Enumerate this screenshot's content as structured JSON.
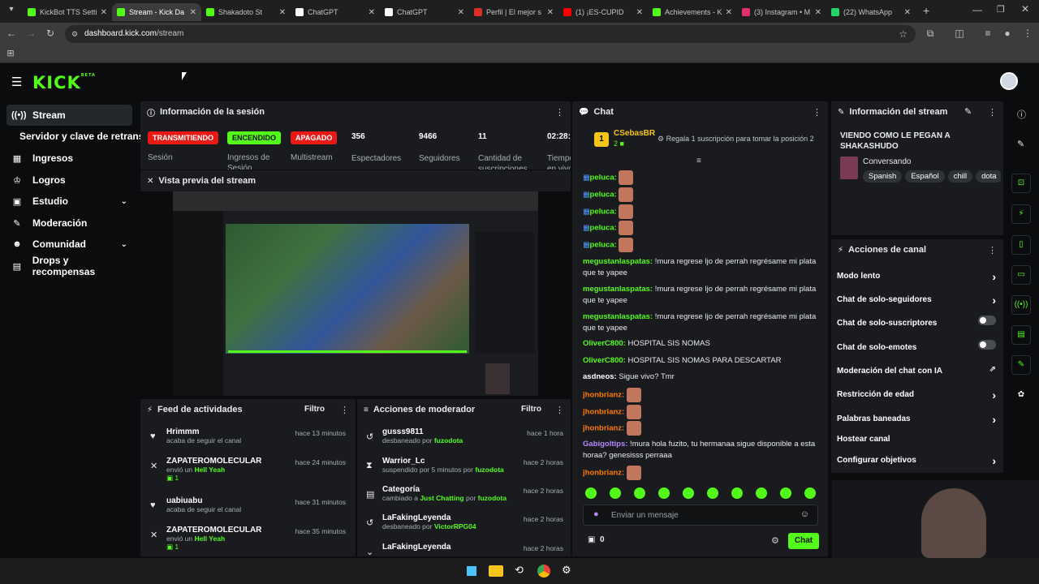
{
  "browser": {
    "tabs": [
      {
        "title": "KickBot TTS Setti",
        "color": "#53fc18"
      },
      {
        "title": "Stream - Kick Da",
        "color": "#53fc18",
        "active": true
      },
      {
        "title": "Shakadoto St",
        "color": "#53fc18"
      },
      {
        "title": "ChatGPT",
        "color": "#ffffff"
      },
      {
        "title": "ChatGPT",
        "color": "#ffffff"
      },
      {
        "title": "Perfil | El mejor s",
        "color": "#d93025"
      },
      {
        "title": "(1) ¡ES-CUPID",
        "color": "#ff0000"
      },
      {
        "title": "Achievements - K",
        "color": "#53fc18"
      },
      {
        "title": "(3) Instagram • M",
        "color": "#e1306c"
      },
      {
        "title": "(22) WhatsApp",
        "color": "#25d366"
      }
    ],
    "url_host": "dashboard.kick.com",
    "url_path": "/stream"
  },
  "header": {
    "logo": "KICK",
    "logo_sup": "BETA"
  },
  "sidebar": {
    "items": [
      {
        "label": "Stream",
        "icon": "broadcast-icon"
      },
      {
        "label": "Servidor y clave de retransmisión",
        "icon": ""
      },
      {
        "label": "Ingresos",
        "icon": "chart-icon"
      },
      {
        "label": "Logros",
        "icon": "trophy-icon"
      },
      {
        "label": "Estudio",
        "icon": "studio-icon"
      },
      {
        "label": "Moderación",
        "icon": "wrench-icon"
      },
      {
        "label": "Comunidad",
        "icon": "people-icon"
      },
      {
        "label": "Drops y recompensas",
        "icon": "gift-icon"
      }
    ]
  },
  "session": {
    "title": "Información de la sesión",
    "transmitting": "TRANSMITIENDO",
    "session_label": "Sesión",
    "encendido": "ENCENDIDO",
    "ingresos_label": "Ingresos de Sesión",
    "apagado": "APAGADO",
    "multistream_label": "Multistream",
    "viewers": "356",
    "viewers_label": "Espectadores",
    "followers": "9466",
    "followers_label": "Seguidores",
    "subs": "11",
    "subs_label": "Cantidad de suscripciones",
    "time": "02:28:",
    "time_label": "Tiempo en vivo"
  },
  "preview": {
    "title": "Vista previa del stream"
  },
  "feed": {
    "title": "Feed de actividades",
    "filter": "Filtro",
    "items": [
      {
        "name": "Hrimmm",
        "desc": "acaba de seguir el canal",
        "time": "hace 13 minutos"
      },
      {
        "name": "ZAPATEROMOLECULAR",
        "desc_pre": "envió un ",
        "desc_link": "Hell Yeah",
        "amount": "1",
        "time": "hace 24 minutos"
      },
      {
        "name": "uabiuabu",
        "desc": "acaba de seguir el canal",
        "time": "hace 31 minutos"
      },
      {
        "name": "ZAPATEROMOLECULAR",
        "desc_pre": "envió un ",
        "desc_link": "Hell Yeah",
        "amount": "1",
        "time": "hace 35 minutos"
      }
    ]
  },
  "modactions": {
    "title": "Acciones de moderador",
    "filter": "Filtro",
    "items": [
      {
        "name": "gusss9811",
        "desc_pre": "desbaneado por ",
        "by": "fuzodota",
        "time": "hace 1 hora"
      },
      {
        "name": "Warrior_Lc",
        "desc_pre": "suspendido por 5 minutos por ",
        "by": "fuzodota",
        "time": "hace 2 horas"
      },
      {
        "name": "Categoría",
        "desc_pre": "cambiado a ",
        "cat": "Just Chatting",
        "desc_mid": " por ",
        "by": "fuzodota",
        "time": "hace 2 horas"
      },
      {
        "name": "LaFakingLeyenda",
        "desc_pre": "desbaneado por ",
        "by": "VictorRPG04",
        "time": "hace 2 horas"
      },
      {
        "name": "LaFakingLeyenda",
        "desc_pre": "",
        "by": "",
        "time": "hace 2 horas"
      }
    ]
  },
  "chat": {
    "title": "Chat",
    "top_user": "CSebasBR",
    "top_rank": "1",
    "top_count": "2",
    "gift_text": "Regala 1 suscripción para tomar la posición 2",
    "messages": [
      {
        "user": "peluca:",
        "color": "#53fc18",
        "text": "",
        "emote": true
      },
      {
        "user": "peluca:",
        "color": "#53fc18",
        "text": "",
        "emote": true
      },
      {
        "user": "peluca:",
        "color": "#53fc18",
        "text": "",
        "emote": true
      },
      {
        "user": "peluca:",
        "color": "#53fc18",
        "text": "",
        "emote": true
      },
      {
        "user": "peluca:",
        "color": "#53fc18",
        "text": "",
        "emote": true
      },
      {
        "user": "megustanlaspatas:",
        "color": "#53fc18",
        "text": " !mura regrese ljo de perrah regrésame mi plata que te yapee"
      },
      {
        "user": "megustanlaspatas:",
        "color": "#53fc18",
        "text": " !mura regrese ljo de perrah regrésame mi plata que te yapee"
      },
      {
        "user": "megustanlaspatas:",
        "color": "#53fc18",
        "text": " !mura regrese ljo de perrah regrésame mi plata que te yapee"
      },
      {
        "user": "OliverC800:",
        "color": "#53fc18",
        "text": " HOSPITAL SIS NOMAS"
      },
      {
        "user": "OliverC800:",
        "color": "#53fc18",
        "text": " HOSPITAL SIS NOMAS PARA DESCARTAR"
      },
      {
        "user": "asdneos:",
        "color": "#ffffff",
        "text": " Sigue vivo? Tmr"
      },
      {
        "user": "jhonbrianz:",
        "color": "#ff7a00",
        "text": "",
        "emote": true
      },
      {
        "user": "jhonbrianz:",
        "color": "#ff7a00",
        "text": "",
        "emote": true
      },
      {
        "user": "jhonbrianz:",
        "color": "#ff7a00",
        "text": "",
        "emote": true
      },
      {
        "user": "Gabigoltips:",
        "color": "#b388ff",
        "text": " !mura hola fuzito, tu hermanaa sigue disponible a esta horaa? genesisss perraaa"
      },
      {
        "user": "jhonbrianz:",
        "color": "#ff7a00",
        "text": "",
        "emote": true
      }
    ],
    "input_placeholder": "Enviar un mensaje",
    "points": "0",
    "send": "Chat"
  },
  "streaminfo": {
    "title": "Información del stream",
    "stream_title": "VIENDO COMO LE PEGAN A SHAKASHUDO",
    "category": "Conversando",
    "tags": [
      "Spanish",
      "Español",
      "chill",
      "dota"
    ]
  },
  "channelactions": {
    "title": "Acciones de canal",
    "items": [
      {
        "label": "Modo lento",
        "kind": "chevron"
      },
      {
        "label": "Chat de solo-seguidores",
        "kind": "chevron"
      },
      {
        "label": "Chat de solo-suscriptores",
        "kind": "toggle"
      },
      {
        "label": "Chat de solo-emotes",
        "kind": "toggle"
      },
      {
        "label": "Moderación del chat con IA",
        "kind": "link"
      },
      {
        "label": "Restricción de edad",
        "kind": "chevron"
      },
      {
        "label": "Palabras baneadas",
        "kind": "chevron"
      },
      {
        "label": "Hostear canal",
        "kind": "none"
      },
      {
        "label": "Configurar objetivos",
        "kind": "chevron"
      }
    ]
  },
  "colors": {
    "brand": "#53fc18",
    "live": "#e91916",
    "panel": "#191b1f"
  }
}
